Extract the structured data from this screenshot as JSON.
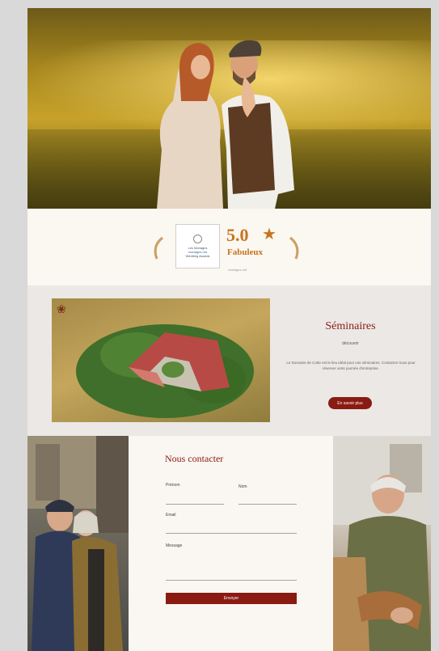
{
  "rating": {
    "badge_line1": "Les Mariages",
    "badge_line2": "mariages.net",
    "badge_line3": "Wedding Awards",
    "score": "5.0",
    "label": "Fabuleux",
    "sub": "mariages.net"
  },
  "seminaires": {
    "title": "Séminaires",
    "subtitle": "découvrir",
    "body": "Le Domaine de Cotte est le lieu idéal pour vos séminaires. Contactez-nous pour réserver votre journée d'entreprise.",
    "button": "En savoir plus"
  },
  "contact": {
    "title": "Nous contacter",
    "first_name": "Prénom",
    "last_name": "Nom",
    "email": "Email",
    "message": "Message",
    "send": "Envoyer"
  },
  "colors": {
    "brand": "#8a1b12",
    "accent": "#c8741c"
  }
}
